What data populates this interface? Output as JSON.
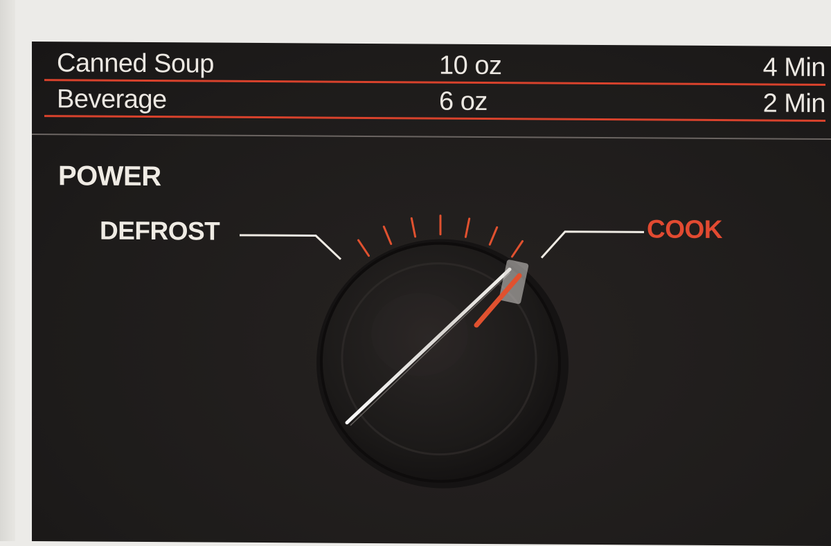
{
  "cooking_guide": {
    "rows": [
      {
        "food": "Canned Soup",
        "amount": "10 oz",
        "time": "4 Min"
      },
      {
        "food": "Beverage",
        "amount": "6 oz",
        "time": "2 Min"
      }
    ]
  },
  "power_control": {
    "title": "POWER",
    "left_label": "DEFROST",
    "right_label": "COOK",
    "tick_count": 7,
    "knob_setting": "COOK"
  },
  "colors": {
    "panel": "#1f1c1b",
    "text": "#ece8e2",
    "accent_red": "#e24a31",
    "page_background": "#ecebe8"
  },
  "icons": {
    "knob": "rotary-knob-icon"
  }
}
